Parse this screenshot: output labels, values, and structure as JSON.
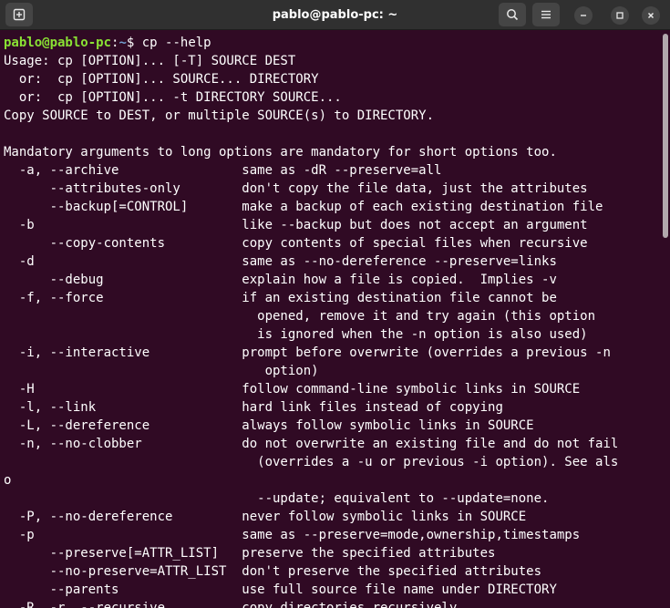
{
  "window": {
    "title": "pablo@pablo-pc: ~",
    "icons": {
      "new_tab": "new-tab-icon",
      "search": "search-icon",
      "menu": "hamburger-menu-icon",
      "minimize": "minimize-icon",
      "maximize": "maximize-icon",
      "close": "close-icon"
    }
  },
  "terminal": {
    "prompt_user": "pablo@pablo-pc",
    "prompt_sep": ":",
    "prompt_path": "~",
    "prompt_end": "$ ",
    "command": "cp --help",
    "colors": {
      "background": "#300a24",
      "user": "#8ae234",
      "path": "#729fcf",
      "text": "#ffffff"
    },
    "lines": [
      "Usage: cp [OPTION]... [-T] SOURCE DEST",
      "  or:  cp [OPTION]... SOURCE... DIRECTORY",
      "  or:  cp [OPTION]... -t DIRECTORY SOURCE...",
      "Copy SOURCE to DEST, or multiple SOURCE(s) to DIRECTORY.",
      "",
      "Mandatory arguments to long options are mandatory for short options too.",
      "  -a, --archive                same as -dR --preserve=all",
      "      --attributes-only        don't copy the file data, just the attributes",
      "      --backup[=CONTROL]       make a backup of each existing destination file",
      "  -b                           like --backup but does not accept an argument",
      "      --copy-contents          copy contents of special files when recursive",
      "  -d                           same as --no-dereference --preserve=links",
      "      --debug                  explain how a file is copied.  Implies -v",
      "  -f, --force                  if an existing destination file cannot be",
      "                                 opened, remove it and try again (this option",
      "                                 is ignored when the -n option is also used)",
      "  -i, --interactive            prompt before overwrite (overrides a previous -n",
      "                                  option)",
      "  -H                           follow command-line symbolic links in SOURCE",
      "  -l, --link                   hard link files instead of copying",
      "  -L, --dereference            always follow symbolic links in SOURCE",
      "  -n, --no-clobber             do not overwrite an existing file and do not fail",
      "                                 (overrides a -u or previous -i option). See als",
      "o",
      "                                 --update; equivalent to --update=none.",
      "  -P, --no-dereference         never follow symbolic links in SOURCE",
      "  -p                           same as --preserve=mode,ownership,timestamps",
      "      --preserve[=ATTR_LIST]   preserve the specified attributes",
      "      --no-preserve=ATTR_LIST  don't preserve the specified attributes",
      "      --parents                use full source file name under DIRECTORY",
      "  -R, -r, --recursive          copy directories recursively"
    ]
  }
}
